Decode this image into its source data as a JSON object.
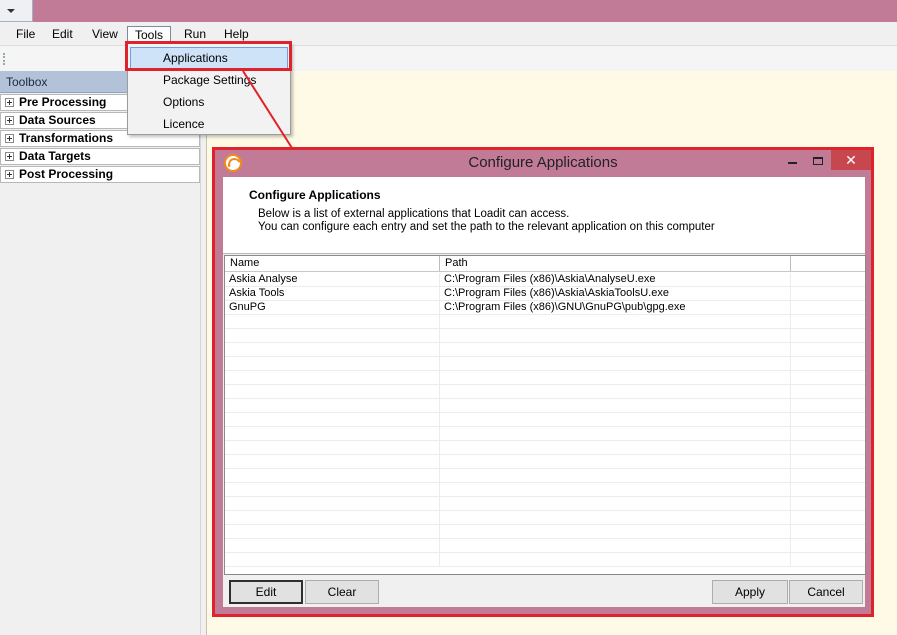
{
  "menubar": {
    "items": [
      "File",
      "Edit",
      "View",
      "Tools",
      "Run",
      "Help"
    ]
  },
  "tools_menu": {
    "items": [
      "Applications",
      "Package Settings",
      "Options",
      "Licence"
    ],
    "highlighted": "Applications"
  },
  "toolbox": {
    "title": "Toolbox",
    "sections": [
      "Pre Processing",
      "Data Sources",
      "Transformations",
      "Data Targets",
      "Post Processing"
    ]
  },
  "dialog": {
    "window_title": "Configure Applications",
    "heading": "Configure Applications",
    "description_line1": "Below is a list of external applications that Loadit can access.",
    "description_line2": "You can configure each entry and set the path to the relevant application on this computer",
    "columns": [
      "Name",
      "Path"
    ],
    "rows": [
      {
        "name": "Askia Analyse",
        "path": "C:\\Program Files (x86)\\Askia\\AnalyseU.exe"
      },
      {
        "name": "Askia Tools",
        "path": "C:\\Program Files (x86)\\Askia\\AskiaToolsU.exe"
      },
      {
        "name": "GnuPG",
        "path": "C:\\Program Files (x86)\\GNU\\GnuPG\\pub\\gpg.exe"
      }
    ],
    "buttons": {
      "edit": "Edit",
      "clear": "Clear",
      "apply": "Apply",
      "cancel": "Cancel"
    }
  },
  "colors": {
    "title_bar": "#c27b97",
    "highlight_outline": "#e0222c",
    "workspace": "#fefae6",
    "toolbox_header": "#b2c3d9"
  },
  "icons": {
    "system_menu": "chevron-down-icon",
    "expand": "plus-box-icon",
    "app": "loadit-icon",
    "minimize": "minimize-icon",
    "maximize": "maximize-icon",
    "close": "close-icon"
  }
}
